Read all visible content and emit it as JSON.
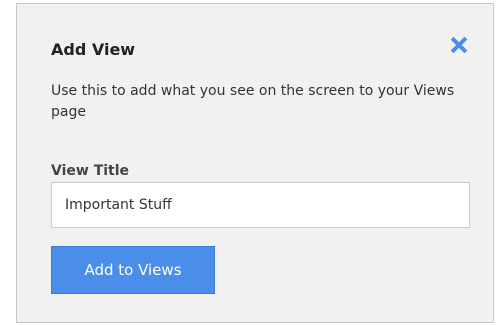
{
  "dialog": {
    "title": "Add View",
    "close_icon": "close-icon",
    "description": "Use this to add what you see on the screen to your Views page",
    "field": {
      "label": "View Title",
      "value": "Important Stuff"
    },
    "add_button_label": "Add to Views"
  },
  "colors": {
    "panel_background": "#f1f1f1",
    "close_icon": "#4a8eea",
    "primary_button": "#4a8eea"
  }
}
